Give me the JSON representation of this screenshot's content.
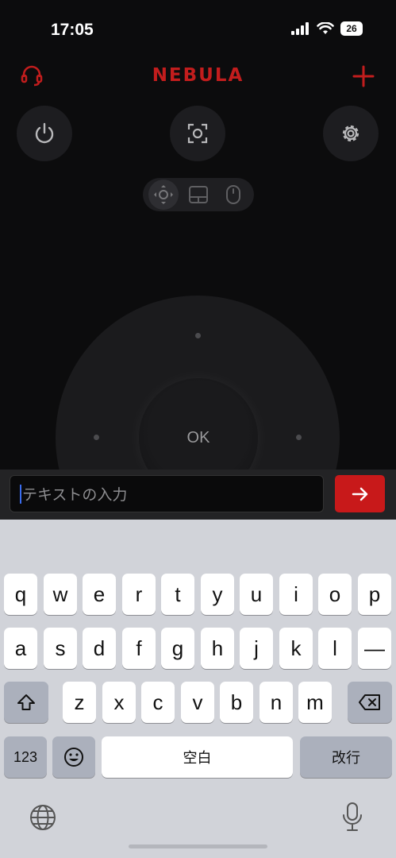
{
  "status": {
    "time": "17:05",
    "battery": "26"
  },
  "header": {
    "brand": "NEBULA"
  },
  "controls": {
    "ok_label": "OK"
  },
  "input": {
    "placeholder": "テキストの入力"
  },
  "keyboard": {
    "row1": [
      "q",
      "w",
      "e",
      "r",
      "t",
      "y",
      "u",
      "i",
      "o",
      "p"
    ],
    "row2": [
      "a",
      "s",
      "d",
      "f",
      "g",
      "h",
      "j",
      "k",
      "l",
      "—"
    ],
    "row3": [
      "z",
      "x",
      "c",
      "v",
      "b",
      "n",
      "m"
    ],
    "numbers_label": "123",
    "space_label": "空白",
    "return_label": "改行"
  },
  "colors": {
    "accent": "#c8191a",
    "background": "#0c0c0d",
    "keyboard": "#d1d3d9"
  }
}
